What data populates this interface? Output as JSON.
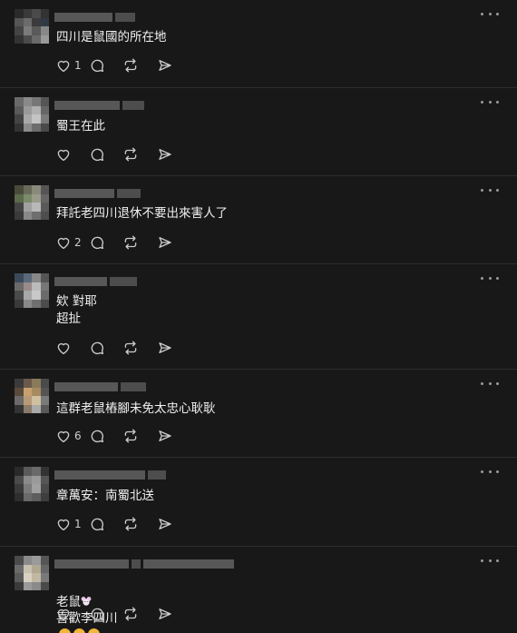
{
  "icons": {
    "like": "heart-icon",
    "reply": "speech-bubble-icon",
    "repost": "repost-arrows-icon",
    "share": "paper-plane-icon",
    "more": "ellipsis-icon"
  },
  "colors": {
    "background": "#181818",
    "divider": "#2d2d2d",
    "text": "#f3f5f7",
    "icon": "#cccccc",
    "censored": "#5f5f5f"
  },
  "posts": [
    {
      "text": "四川是鼠國的所在地",
      "likes": "1"
    },
    {
      "text": "蜀王在此",
      "likes": ""
    },
    {
      "text": "拜託老四川退休不要出來害人了",
      "likes": "2"
    },
    {
      "text_lines": [
        "欸 對耶",
        "超扯"
      ],
      "likes": ""
    },
    {
      "text": "這群老鼠樁腳未免太忠心耿耿",
      "likes": "6"
    },
    {
      "text": "章萬安：南蜀北送",
      "likes": "1"
    },
    {
      "text_parts": [
        "老鼠",
        "喜歡李四川"
      ],
      "likes": ""
    }
  ]
}
